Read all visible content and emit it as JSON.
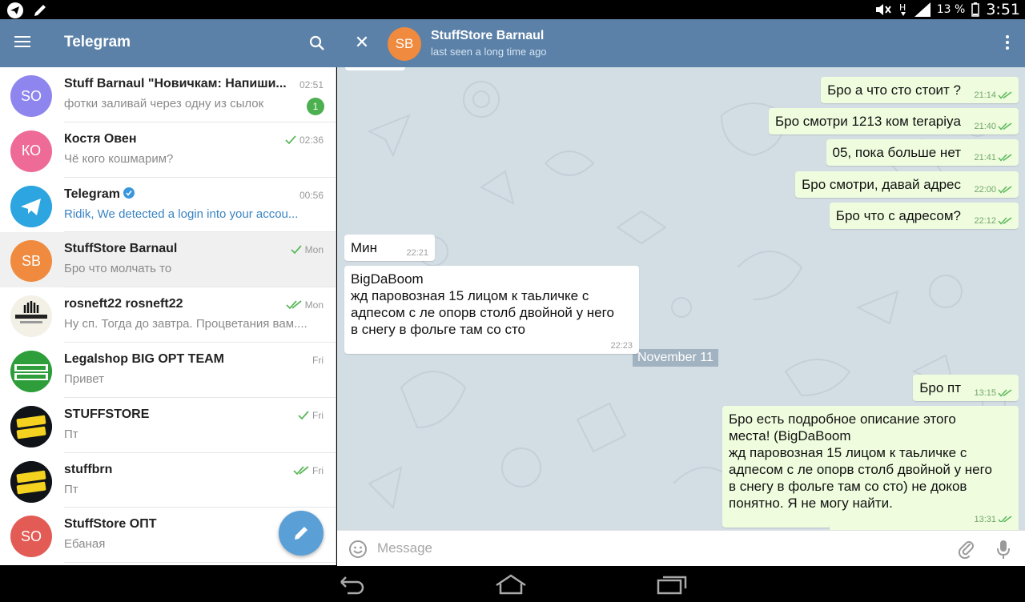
{
  "status_bar": {
    "battery": "13 %",
    "time": "3:51"
  },
  "sidebar": {
    "title": "Telegram",
    "chats": [
      {
        "avatar_text": "SO",
        "avatar_color": "#8e85ee",
        "name": "Stuff  Barnaul \"Новичкам: Напиши...",
        "message": "фотки заливай через одну из сылок",
        "time": "02:51",
        "unread": "1",
        "check": "none"
      },
      {
        "avatar_text": "КО",
        "avatar_color": "#ee6a97",
        "name": "Костя Овен",
        "message": "Чё кого кошмарим?",
        "time": "02:36",
        "check": "single"
      },
      {
        "avatar_text": "",
        "avatar_color": "#2ca5e0",
        "name": "Telegram",
        "message": "Ridik, We detected a login into your accou...",
        "time": "00:56",
        "check": "none",
        "verified": true
      },
      {
        "avatar_text": "SB",
        "avatar_color": "#ef8a3e",
        "name": "StuffStore Barnaul",
        "message": "Бро что молчать то",
        "time": "Mon",
        "check": "single"
      },
      {
        "avatar_text": "",
        "avatar_color": "#f3f0e6",
        "name": "rosneft22 rosneft22",
        "message": "Ну сп. Тогда до завтра. Процветания вам....",
        "time": "Mon",
        "check": "double"
      },
      {
        "avatar_text": "",
        "avatar_color": "#2e9e3a",
        "name": "Legalshop BIG OPT TEAM",
        "message": "Привет",
        "time": "Fri",
        "check": "none"
      },
      {
        "avatar_text": "",
        "avatar_color": "#101418",
        "name": "STUFFSTORE",
        "message": "Пт",
        "time": "Fri",
        "check": "single"
      },
      {
        "avatar_text": "",
        "avatar_color": "#101418",
        "name": "stuffbrn",
        "message": "Пт",
        "time": "Fri",
        "check": "double"
      },
      {
        "avatar_text": "SO",
        "avatar_color": "#e35b55",
        "name": "StuffStore ОПТ",
        "message": "Ебаная",
        "time": "",
        "check": "none"
      }
    ]
  },
  "conversation": {
    "avatar_text": "SB",
    "name": "StuffStore Barnaul",
    "status": "last seen a long time ago",
    "date_divider": "November 11",
    "messages": [
      {
        "dir": "out",
        "text": "Бро а что сто стоит ?",
        "time": "21:14"
      },
      {
        "dir": "out",
        "text": "Бро смотри 1213 ком terapiya",
        "time": "21:40"
      },
      {
        "dir": "out",
        "text": "05, пока больше нет",
        "time": "21:41"
      },
      {
        "dir": "out",
        "text": "Бро смотри, давай адрес",
        "time": "22:00"
      },
      {
        "dir": "out",
        "text": "Бро что с адресом?",
        "time": "22:12"
      },
      {
        "dir": "in",
        "text": "Мин",
        "time": "22:21"
      },
      {
        "dir": "in",
        "text": "BigDaBoom\nжд паровозная 15 лицом к таьличке с\nадпесом с ле опорв столб двойной у него\nв снегу в фольге там со сто",
        "time": "22:23"
      },
      {
        "dir": "out",
        "text": "Бро пт",
        "time": "13:15"
      },
      {
        "dir": "out",
        "text": "Бро есть подробное описание этого\nместа!  (BigDaBoom\nжд паровозная 15 лицом к таьличке с\nадпесом с ле опорв столб двойной у него\nв снегу в фольге там со сто) не доков\nпонятно. Я не могу найти.",
        "time": "13:31"
      }
    ],
    "input_placeholder": "Message"
  },
  "colors": {
    "header": "#5b81a8",
    "out_bubble": "#effdde",
    "chat_bg": "#d3dde4",
    "check": "#5cb85c"
  }
}
